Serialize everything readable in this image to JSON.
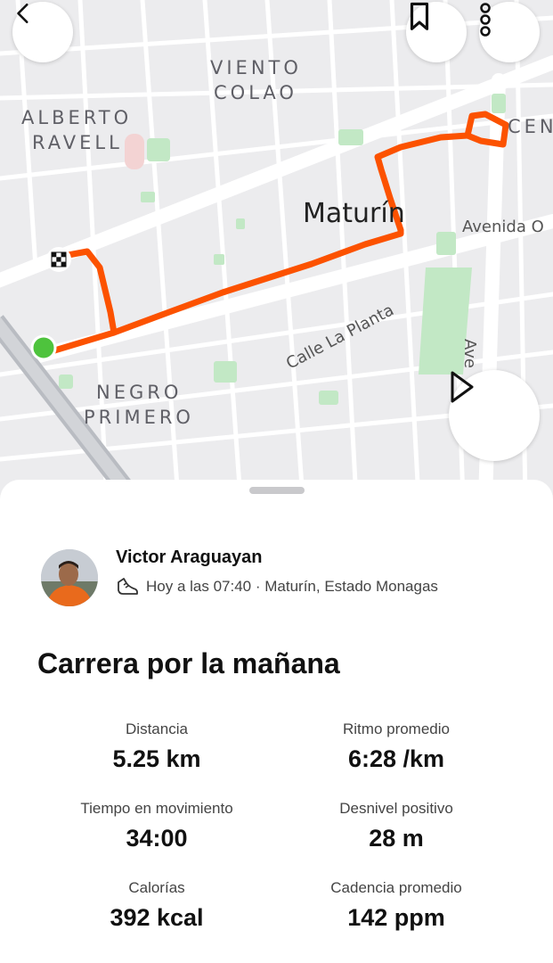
{
  "map": {
    "neighborhoods": [
      "VIENTO",
      "COLAO",
      "ALBERTO",
      "RAVELL",
      "NEGRO",
      "PRIMERO"
    ],
    "city": "Maturín",
    "partial_labels": {
      "centro": "CEN",
      "avenida_right": "Ave"
    },
    "streets": [
      "Avenida O",
      "Calle La Planta"
    ],
    "route_color": "#fc5200",
    "start_color": "#4ec33d"
  },
  "header": {
    "back_icon": "chevron-left-icon",
    "bookmark_icon": "bookmark-icon",
    "more_icon": "more-vertical-icon",
    "play_icon": "play-icon"
  },
  "activity": {
    "athlete": "Victor Araguayan",
    "icon": "running-shoe-icon",
    "meta": "Hoy a las 07:40 · Maturín, Estado Monagas",
    "title": "Carrera por la mañana"
  },
  "stats": [
    {
      "label": "Distancia",
      "value": "5.25 km"
    },
    {
      "label": "Ritmo promedio",
      "value": "6:28 /km"
    },
    {
      "label": "Tiempo en movimiento",
      "value": "34:00"
    },
    {
      "label": "Desnivel positivo",
      "value": "28 m"
    },
    {
      "label": "Calorías",
      "value": "392 kcal"
    },
    {
      "label": "Cadencia promedio",
      "value": "142 ppm"
    }
  ]
}
